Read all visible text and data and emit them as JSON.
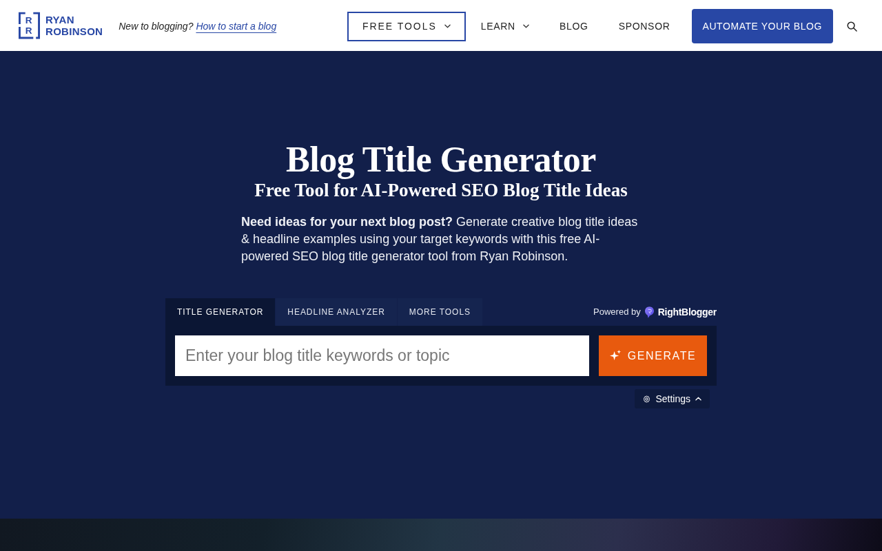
{
  "header": {
    "logo": {
      "mark": [
        "R",
        "R"
      ],
      "line_1": "RYAN",
      "line_2": "ROBINSON"
    },
    "tagline": {
      "text": "New to blogging?",
      "link": "How to start a blog"
    },
    "nav": [
      {
        "label": "FREE TOOLS",
        "dropdown": true,
        "selected": true
      },
      {
        "label": "LEARN",
        "dropdown": true,
        "selected": false
      },
      {
        "label": "BLOG",
        "dropdown": false,
        "selected": false
      },
      {
        "label": "SPONSOR",
        "dropdown": false,
        "selected": false
      }
    ],
    "cta_button": "AUTOMATE YOUR BLOG"
  },
  "hero": {
    "title": "Blog Title Generator",
    "subtitle": "Free Tool for AI-Powered SEO Blog Title Ideas",
    "intro": "**Need ideas for your next blog post?** Generate creative blog title ideas & headline examples using your target keywords with this free AI-powered SEO blog title generator tool from Ryan Robinson."
  },
  "tool": {
    "tabs": [
      {
        "label": "TITLE GENERATOR",
        "selected": true
      },
      {
        "label": "HEADLINE ANALYZER",
        "selected": false
      },
      {
        "label": "MORE TOOLS",
        "selected": false
      }
    ],
    "powered_by": {
      "label": "Powered by",
      "brand": "RightBlogger"
    },
    "input": {
      "placeholder": "Enter your blog title keywords or topic"
    },
    "generate_button": "GENERATE",
    "settings": {
      "label": "Settings",
      "expanded": true
    }
  }
}
